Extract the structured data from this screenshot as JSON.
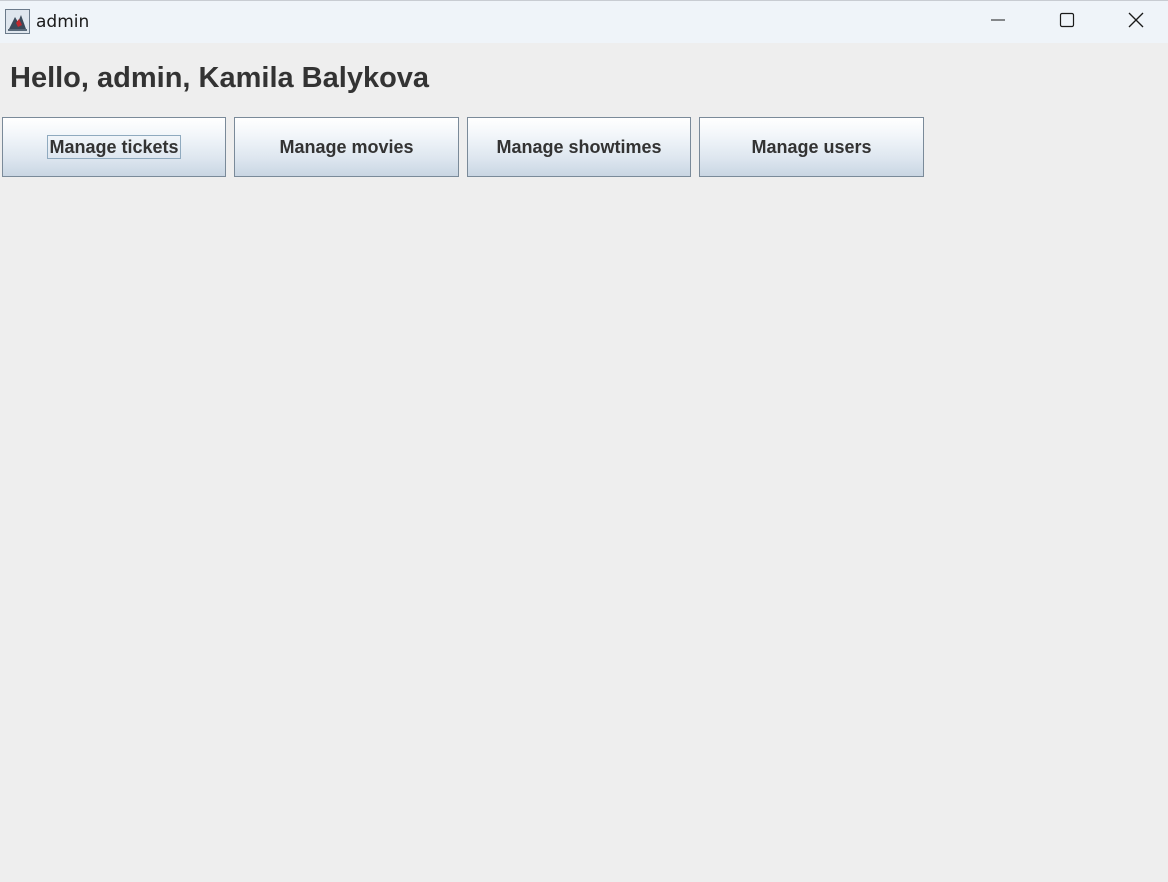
{
  "window": {
    "title": "admin",
    "icon": "java-app-icon",
    "controls": {
      "minimize": "minimize-icon",
      "maximize": "maximize-icon",
      "close": "close-icon"
    }
  },
  "main": {
    "greeting": "Hello, admin, Kamila Balykova",
    "buttons": {
      "tickets": "Manage tickets",
      "movies": "Manage movies",
      "showtimes": "Manage showtimes",
      "users": "Manage users"
    },
    "focused_button": "Manage tickets"
  },
  "colors": {
    "background": "#eeeeee",
    "titlebar": "#eff4f9",
    "text": "#333333",
    "button_border": "#7a8a99"
  }
}
